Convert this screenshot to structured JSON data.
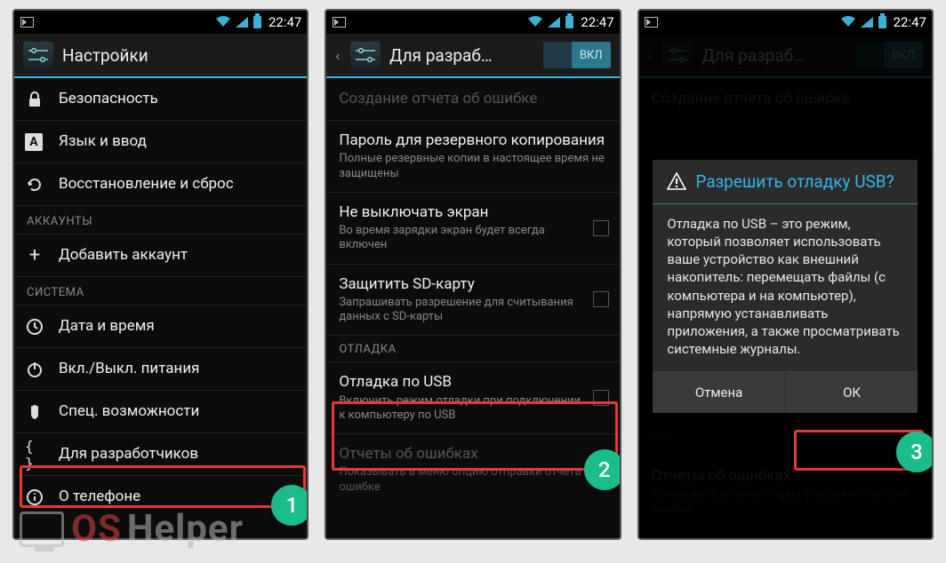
{
  "status": {
    "time": "22:47"
  },
  "screen1": {
    "title": "Настройки",
    "rows": [
      {
        "icon": "lock",
        "label": "Безопасность"
      },
      {
        "icon": "A",
        "label": "Язык и ввод"
      },
      {
        "icon": "restore",
        "label": "Восстановление и сброс"
      }
    ],
    "section_accounts": "АККАУНТЫ",
    "add_account": "Добавить аккаунт",
    "section_system": "СИСТЕМА",
    "system_rows": [
      {
        "icon": "clock",
        "label": "Дата и время"
      },
      {
        "icon": "power",
        "label": "Вкл./Выкл. питания"
      },
      {
        "icon": "hand",
        "label": "Спец. возможности"
      },
      {
        "icon": "braces",
        "label": "Для разработчиков"
      },
      {
        "icon": "info",
        "label": "О телефоне"
      }
    ],
    "badge": "1"
  },
  "screen2": {
    "title": "Для разраб…",
    "toggle": "ВКЛ",
    "rows": [
      {
        "title": "Создание отчета об ошибке",
        "dim": true
      },
      {
        "title": "Пароль для резервного копирования",
        "sub": "Полные резервные копии в настоящее время не защищены"
      },
      {
        "title": "Не выключать экран",
        "sub": "Во время зарядки экран будет всегда включен",
        "checkbox": true
      },
      {
        "title": "Защитить SD-карту",
        "sub": "Запрашивать разрешение для считывания данных с SD-карты",
        "checkbox": true
      }
    ],
    "section_debug": "ОТЛАДКА",
    "usb_row": {
      "title": "Отладка по USB",
      "sub": "Включить режим отладки при подключении к компьютеру по USB",
      "checkbox": true
    },
    "error_row": {
      "title": "Отчеты об ошибках",
      "sub": "Показывать в меню опцию отправки отчета об ошибке",
      "dim": true
    },
    "badge": "2"
  },
  "screen3": {
    "title": "Для разраб…",
    "toggle": "ВКЛ",
    "bg_rows": [
      {
        "title": "Создание отчета об ошибке"
      }
    ],
    "bg_usb": "USB",
    "bg_err_title": "Отчеты об ошибках",
    "bg_err_sub": "Показывать в меню опцию отправки отчета об ошибке",
    "dialog": {
      "title": "Разрешить отладку USB?",
      "body": "Отладка по USB – это режим, который позволяет использовать ваше устройство как внешний накопитель: перемещать файлы (с компьютера и на компьютер), напрямую устанавливать приложения, а также просматривать системные журналы.",
      "cancel": "Отмена",
      "ok": "ОК"
    },
    "badge": "3"
  },
  "watermark": {
    "os": "OS",
    "helper": "Helper"
  }
}
